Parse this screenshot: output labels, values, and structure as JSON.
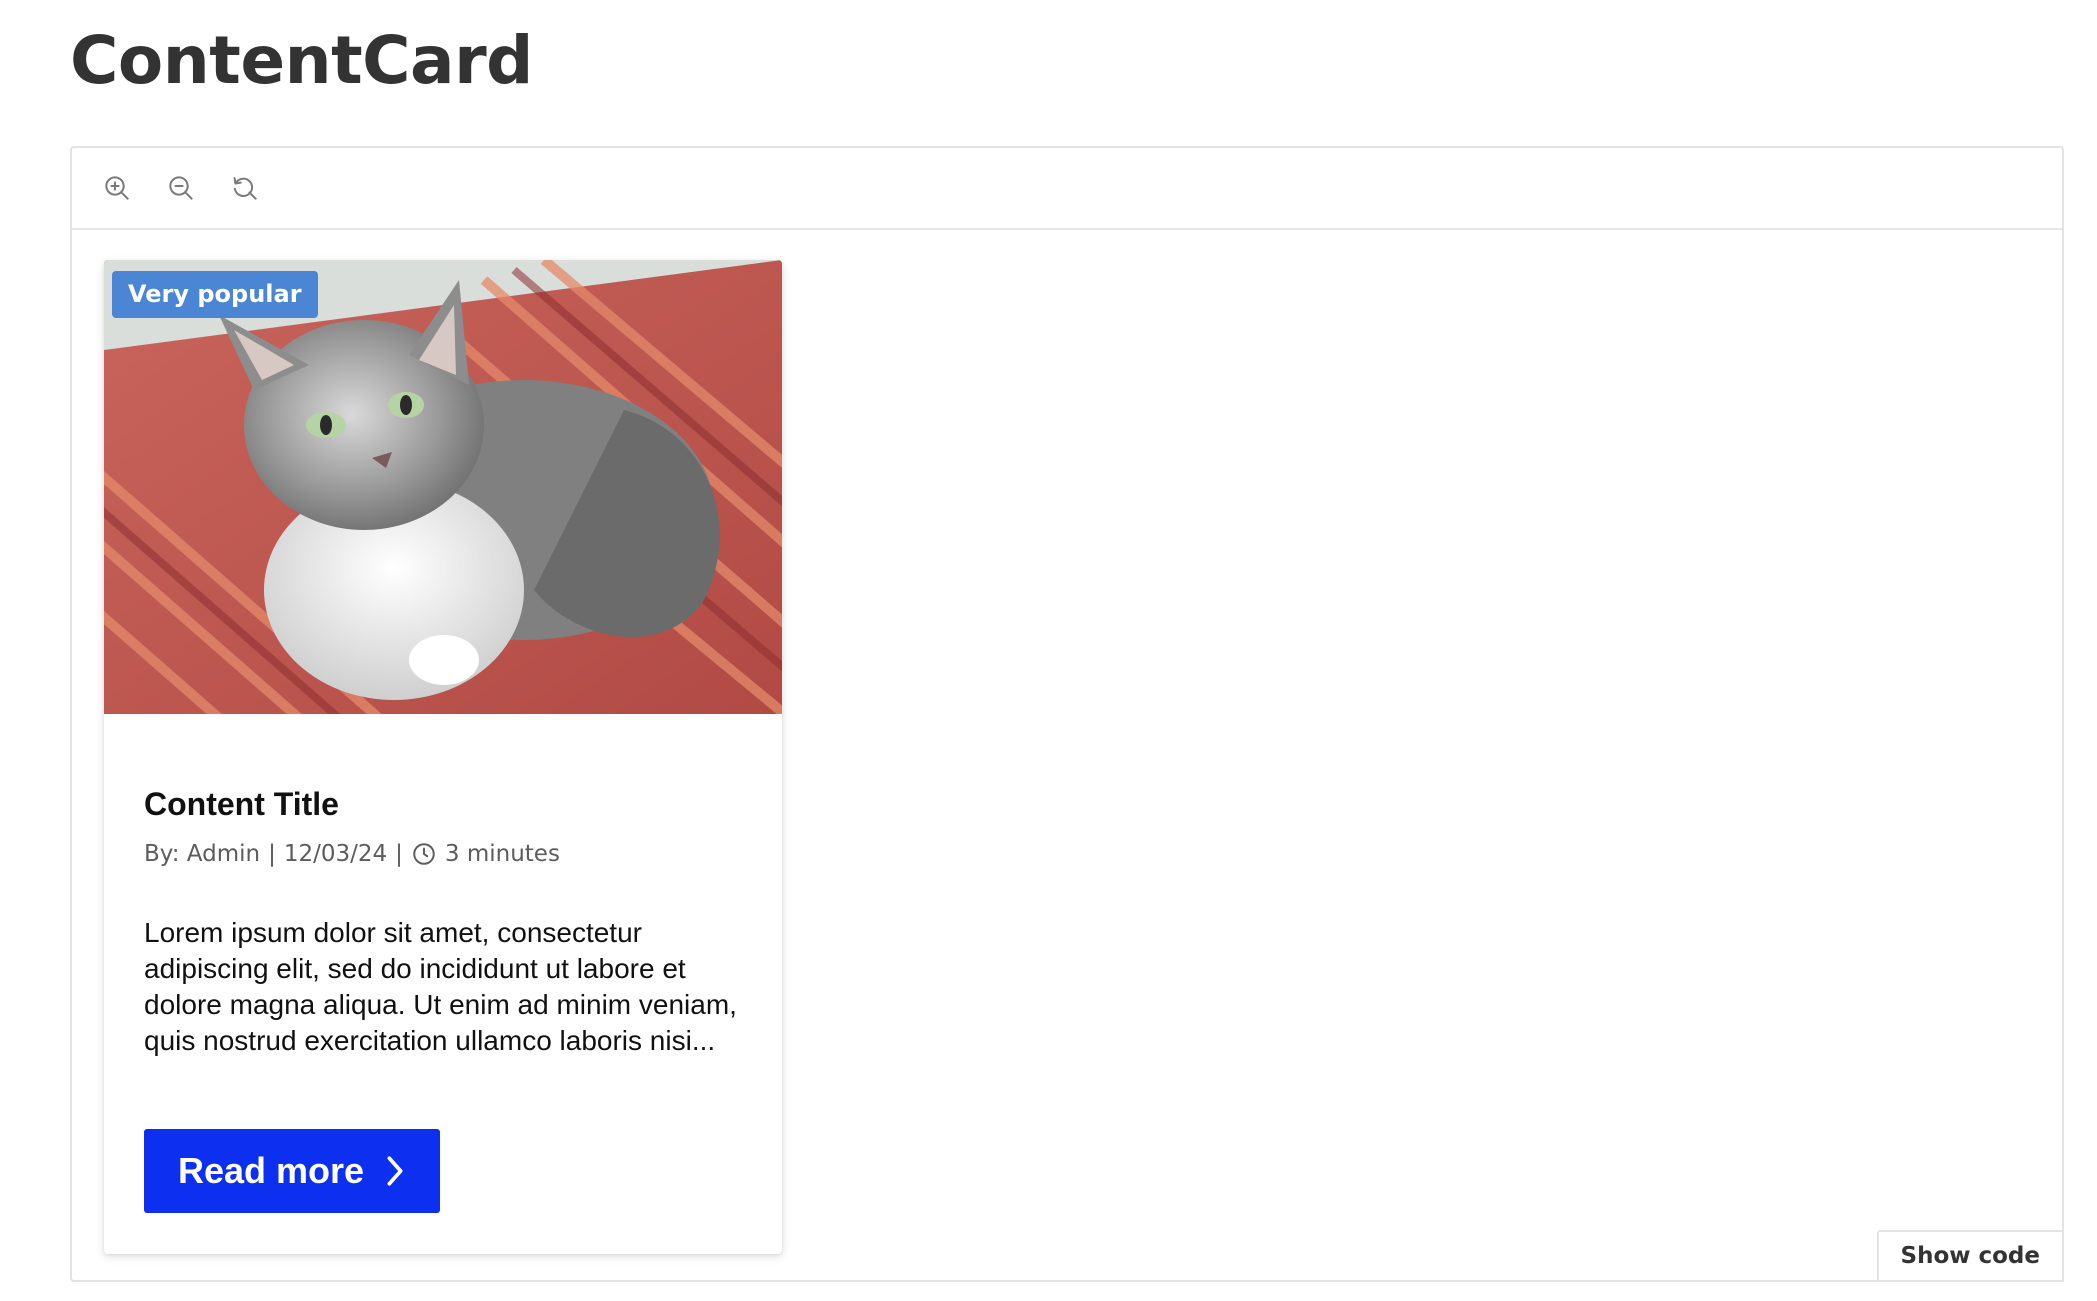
{
  "page": {
    "title": "ContentCard"
  },
  "toolbar": {
    "icons": [
      "zoom-in-icon",
      "zoom-out-icon",
      "reset-zoom-icon"
    ]
  },
  "card": {
    "badge": "Very popular",
    "title": "Content Title",
    "meta": {
      "author": "By: Admin",
      "separator": "|",
      "date": "12/03/24",
      "read_time": "3 minutes",
      "clock_icon": "clock-icon"
    },
    "excerpt": "Lorem ipsum dolor sit amet, consectetur adipiscing elit, sed do incididunt ut labore et dolore magna aliqua. Ut enim ad minim veniam, quis nostrud exercitation ullamco laboris nisi...",
    "button_label": "Read more",
    "button_icon": "chevron-right-icon"
  },
  "footer": {
    "show_code_label": "Show code"
  },
  "colors": {
    "badge_bg": "#4a86d4",
    "button_bg": "#0d2ff0",
    "title_text": "#333333"
  }
}
